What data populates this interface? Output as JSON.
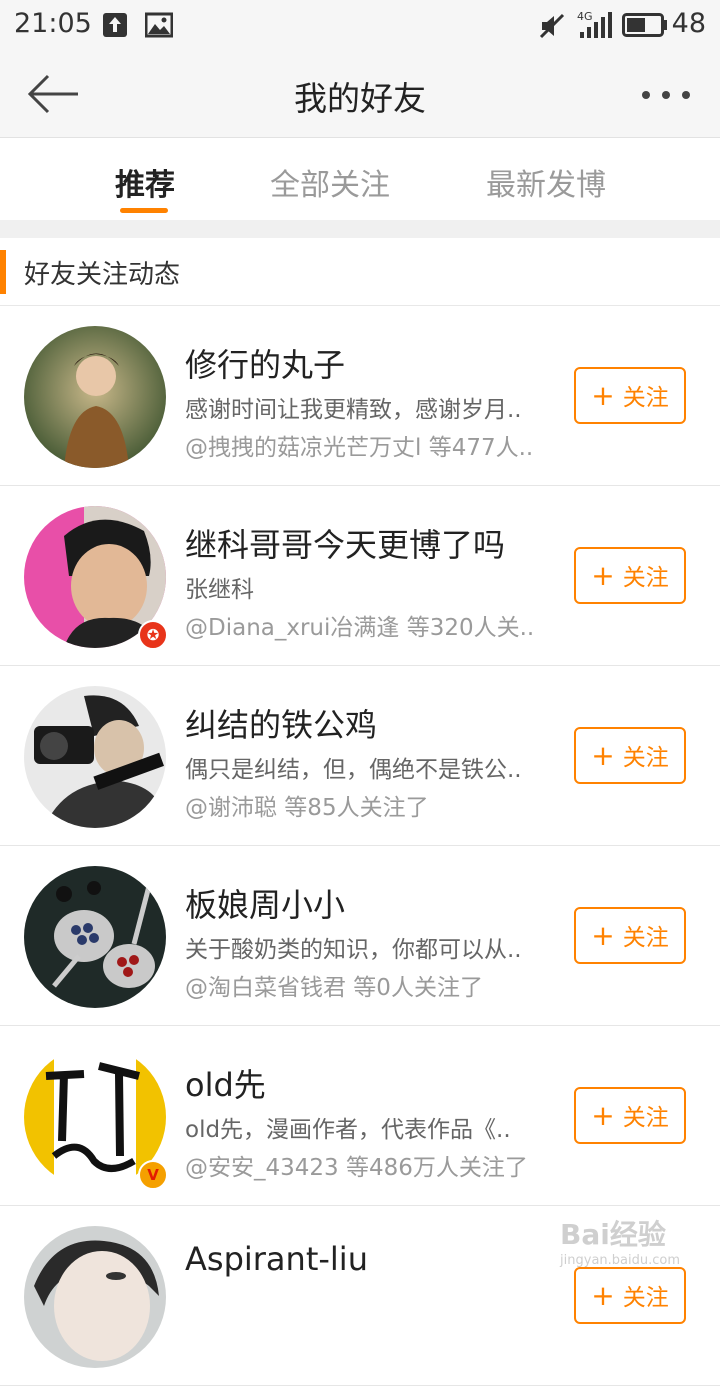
{
  "status_bar": {
    "time": "21:05",
    "battery": "48",
    "network": "4G",
    "icons": [
      "upload-icon",
      "image-icon",
      "mute-icon",
      "signal-icon",
      "battery-icon"
    ]
  },
  "header": {
    "title": "我的好友",
    "back_icon": "back-arrow-icon",
    "more_icon": "more-dots-icon"
  },
  "tabs": [
    {
      "label": "推荐",
      "active": true
    },
    {
      "label": "全部关注",
      "active": false
    },
    {
      "label": "最新发博",
      "active": false
    }
  ],
  "section": {
    "title": "好友关注动态"
  },
  "colors": {
    "accent": "#ff8200",
    "badge_red": "#e8341a",
    "badge_gold": "#f5a000"
  },
  "follow_label": "关注",
  "users": [
    {
      "name": "修行的丸子",
      "desc": "感谢时间让我更精致，感谢岁月..",
      "meta": "@拽拽的菇凉光芒万丈l 等477人..",
      "badge": ""
    },
    {
      "name": "继科哥哥今天更博了吗",
      "desc": "张继科",
      "meta": "@Diana_xrui冶满逢 等320人关..",
      "badge": "star"
    },
    {
      "name": "纠结的铁公鸡",
      "desc": "偶只是纠结，但，偶绝不是铁公..",
      "meta": "@谢沛聪 等85人关注了",
      "badge": ""
    },
    {
      "name": "板娘周小小",
      "desc": "关于酸奶类的知识，你都可以从..",
      "meta": "@淘白菜省钱君 等0人关注了",
      "badge": ""
    },
    {
      "name": "old先",
      "desc": "old先，漫画作者，代表作品《..",
      "meta": "@安安_43423 等486万人关注了",
      "badge": "V"
    },
    {
      "name": "Aspirant-liu",
      "desc": "",
      "meta": "",
      "badge": ""
    }
  ],
  "watermark": {
    "brand": "Bai经验",
    "url": "jingyan.baidu.com"
  }
}
